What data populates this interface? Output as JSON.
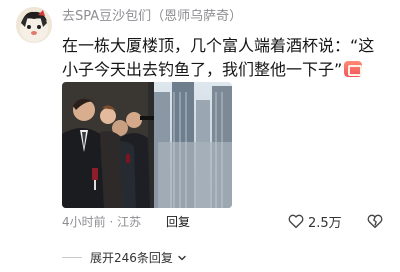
{
  "comment": {
    "username": "去SPA豆沙包们（恩师乌萨奇）",
    "text": "在一栋大厦楼顶，几个富人端着酒杯说：“这小子今天出去钓鱼了，我们整他一下子”",
    "time": "4小时前 · 江苏",
    "reply_label": "回复",
    "like_count": "2.5万",
    "expand_label": "展开246条回复"
  },
  "colors": {
    "badge": "#f1545e",
    "muted_text": "#8e8e93"
  },
  "icons": {
    "like": "heart-outline-icon",
    "dislike": "broken-heart-icon",
    "expand": "chevron-down-icon",
    "badge": "image-badge-icon"
  }
}
